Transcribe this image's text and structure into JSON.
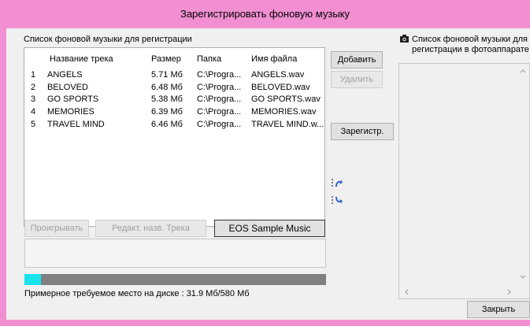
{
  "window": {
    "title": "Зарегистрировать фоновую музыку"
  },
  "left_panel": {
    "label": "Список фоновой музыки для регистрации",
    "columns": [
      "Название трека",
      "Размер",
      "Папка",
      "Имя файла"
    ],
    "rows": [
      {
        "num": "1",
        "name": "ANGELS",
        "size": "5.71 Мб",
        "folder": "C:\\Progra...",
        "file": "ANGELS.wav"
      },
      {
        "num": "2",
        "name": "BELOVED",
        "size": "6.48 Мб",
        "folder": "C:\\Progra...",
        "file": "BELOVED.wav"
      },
      {
        "num": "3",
        "name": "GO SPORTS",
        "size": "5.38 Мб",
        "folder": "C:\\Progra...",
        "file": "GO SPORTS.wav"
      },
      {
        "num": "4",
        "name": "MEMORIES",
        "size": "6.39 Мб",
        "folder": "C:\\Progra...",
        "file": "MEMORIES.wav"
      },
      {
        "num": "5",
        "name": "TRAVEL MIND",
        "size": "6.46 Мб",
        "folder": "C:\\Progra...",
        "file": "TRAVEL MIND.w..."
      }
    ]
  },
  "buttons": {
    "add": "Добавить",
    "delete": "Удалить",
    "register": "Зарегистр.",
    "play": "Проигрывать",
    "edit_name": "Редакт. назв. Трека",
    "eos_sample": "EOS Sample Music",
    "close": "Закрыть"
  },
  "icons": {
    "move_up": "move-up-icon",
    "move_down": "move-down-icon",
    "camera": "camera-icon"
  },
  "disk": {
    "text": "Примерное требуемое место на диске : 31.9 Мб/580 Мб",
    "used_fraction": 0.055
  },
  "right_panel": {
    "label_line1": "Список фоновой музыки для",
    "label_line2": "регистрации в фотоаппарате"
  },
  "colors": {
    "title_bar": "#f18fd2",
    "progress_fill": "#19e3ed",
    "progress_bg": "#808080"
  }
}
